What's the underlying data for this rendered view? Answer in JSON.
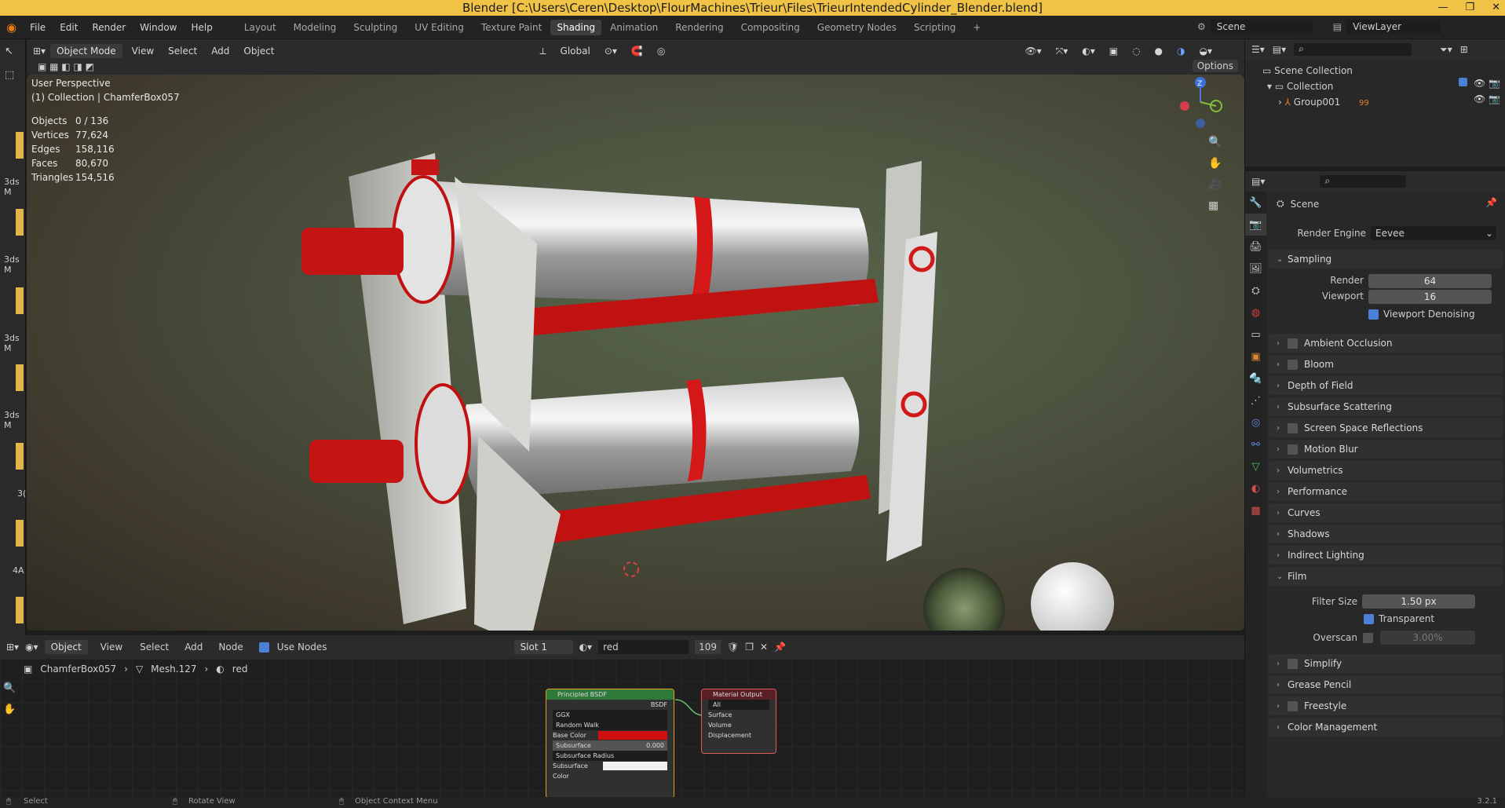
{
  "window": {
    "title": "Blender [C:\\Users\\Ceren\\Desktop\\FlourMachines\\Trieur\\Files\\TrieurIntendedCylinder_Blender.blend]",
    "buttons": [
      "—",
      "❐",
      "✕"
    ]
  },
  "menu": [
    "File",
    "Edit",
    "Render",
    "Window",
    "Help"
  ],
  "workspaces": [
    "Layout",
    "Modeling",
    "Sculpting",
    "UV Editing",
    "Texture Paint",
    "Shading",
    "Animation",
    "Rendering",
    "Compositing",
    "Geometry Nodes",
    "Scripting",
    "+"
  ],
  "active_workspace": "Shading",
  "scene": {
    "name": "Scene",
    "viewlayer": "ViewLayer"
  },
  "viewport_header": {
    "mode": "Object Mode",
    "menus": [
      "View",
      "Select",
      "Add",
      "Object"
    ],
    "orientation": "Global",
    "options": "Options"
  },
  "viewport": {
    "perspective": "User Perspective",
    "collection_line": "(1) Collection | ChamferBox057",
    "stats": [
      {
        "k": "Objects",
        "v": "0 / 136"
      },
      {
        "k": "Vertices",
        "v": "77,624"
      },
      {
        "k": "Edges",
        "v": "158,116"
      },
      {
        "k": "Faces",
        "v": "80,670"
      },
      {
        "k": "Triangles",
        "v": "154,516"
      }
    ],
    "gizmo": {
      "z": "Z"
    }
  },
  "left_strip_labels": [
    "3ds M",
    "3ds M",
    "3ds M",
    "3ds M",
    "3(",
    "4A"
  ],
  "outliner": {
    "items": [
      {
        "label": "Scene Collection"
      },
      {
        "label": "Collection"
      },
      {
        "label": "Group001",
        "badge": "99"
      }
    ]
  },
  "properties": {
    "title": "Scene",
    "render_engine_label": "Render Engine",
    "render_engine": "Eevee",
    "sampling": {
      "title": "Sampling",
      "render_label": "Render",
      "render": "64",
      "viewport_label": "Viewport",
      "viewport": "16",
      "denoise": "Viewport Denoising"
    },
    "sections": [
      "Ambient Occlusion",
      "Bloom",
      "Depth of Field",
      "Subsurface Scattering",
      "Screen Space Reflections",
      "Motion Blur",
      "Volumetrics",
      "Performance",
      "Curves",
      "Shadows",
      "Indirect Lighting"
    ],
    "film": {
      "title": "Film",
      "filter_label": "Filter Size",
      "filter": "1.50 px",
      "transparent": "Transparent",
      "overscan_label": "Overscan",
      "overscan": "3.00%"
    },
    "sections2": [
      "Simplify",
      "Grease Pencil",
      "Freestyle",
      "Color Management"
    ]
  },
  "node_header": {
    "type": "Object",
    "menus": [
      "View",
      "Select",
      "Add",
      "Node"
    ],
    "use_nodes": "Use Nodes",
    "slot": "Slot 1",
    "material": "red",
    "users": "109"
  },
  "breadcrumb": [
    "ChamferBox057",
    "Mesh.127",
    "red"
  ],
  "nodes": {
    "bsdf": {
      "title": "Principled BSDF",
      "out": "BSDF",
      "dist": "GGX",
      "sss": "Random Walk",
      "base": "Base Color",
      "subsurface": "Subsurface",
      "subsurface_val": "0.000",
      "radius": "Subsurface Radius",
      "sss_color": "Subsurface Color",
      "color": "#d01010"
    },
    "output": {
      "title": "Material Output",
      "target": "All",
      "inputs": [
        "Surface",
        "Volume",
        "Displacement"
      ]
    }
  },
  "statusbar": {
    "select": "Select",
    "rotate": "Rotate View",
    "context": "Object Context Menu",
    "version": "3.2.1"
  }
}
